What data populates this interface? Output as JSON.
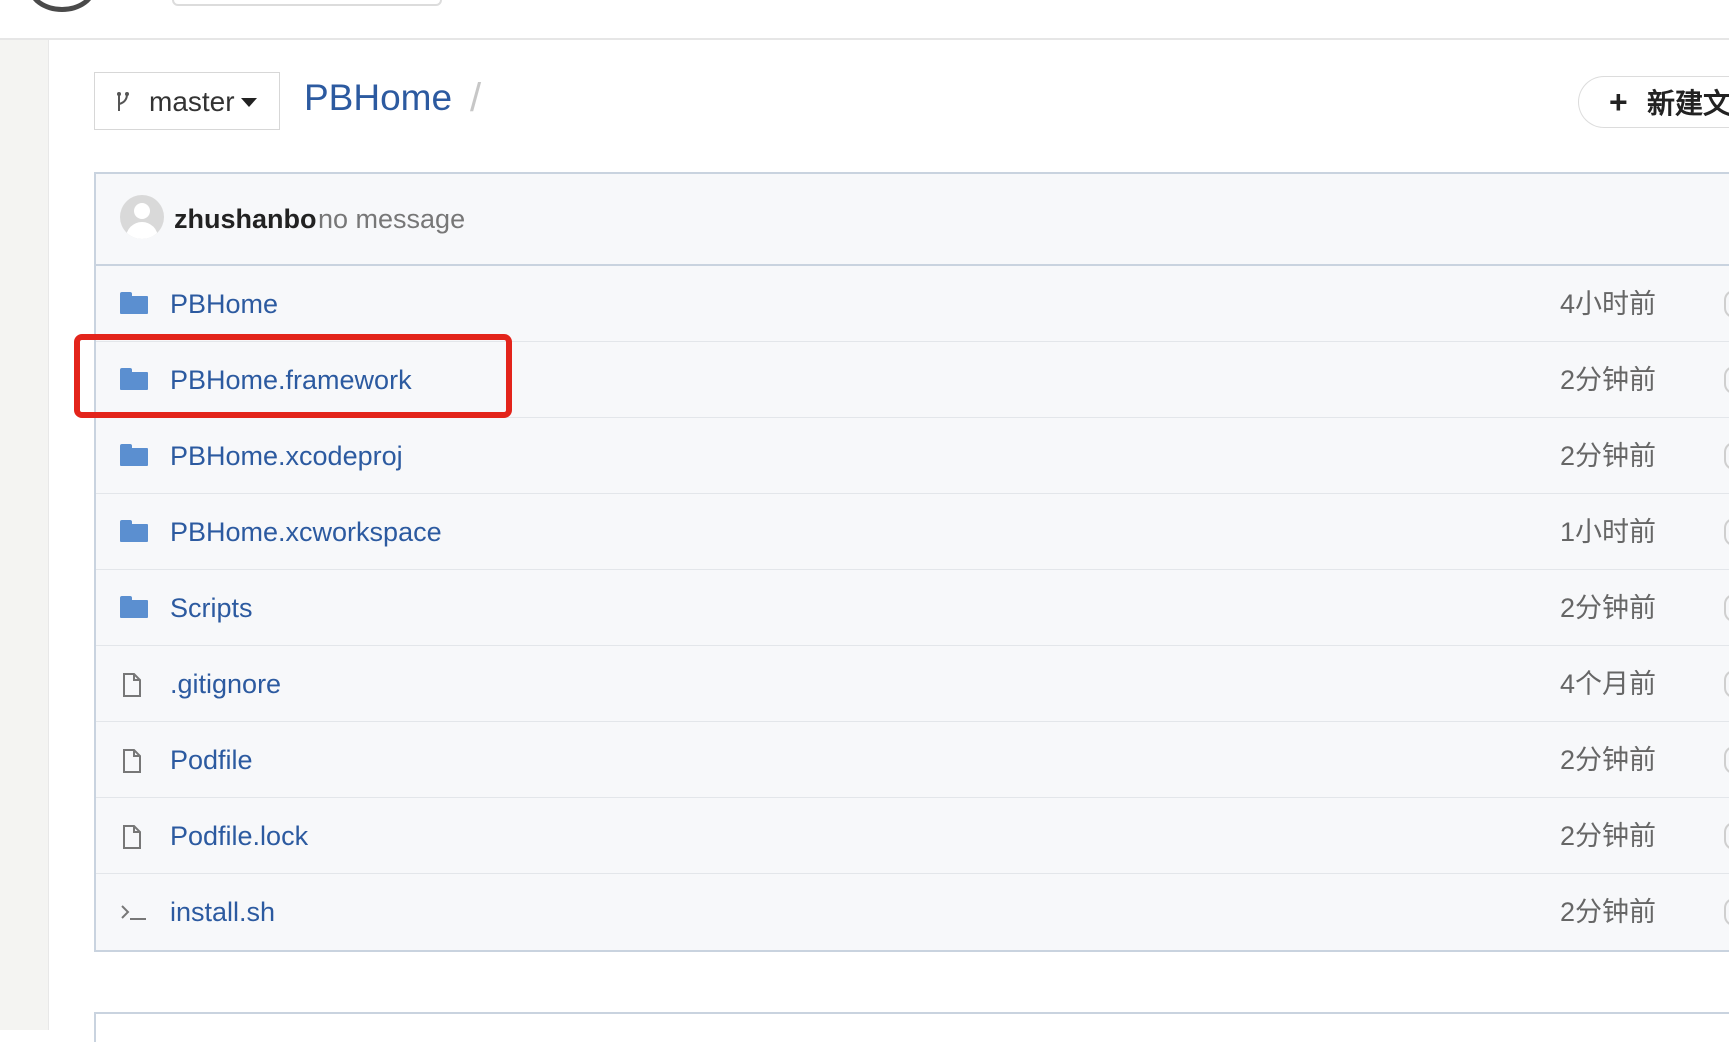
{
  "branch": {
    "label": "master",
    "icon": "git-branch-icon"
  },
  "breadcrumb": {
    "repo": "PBHome",
    "separator": "/"
  },
  "new_file_button": {
    "plus": "+",
    "label": "新建文"
  },
  "commit": {
    "author": "zhushanbo",
    "message": "no message"
  },
  "files": [
    {
      "name": "PBHome",
      "time": "4小时前",
      "icon": "folder-icon"
    },
    {
      "name": "PBHome.framework",
      "time": "2分钟前",
      "icon": "folder-icon"
    },
    {
      "name": "PBHome.xcodeproj",
      "time": "2分钟前",
      "icon": "folder-icon"
    },
    {
      "name": "PBHome.xcworkspace",
      "time": "1小时前",
      "icon": "folder-icon"
    },
    {
      "name": "Scripts",
      "time": "2分钟前",
      "icon": "folder-icon"
    },
    {
      "name": ".gitignore",
      "time": "4个月前",
      "icon": "file-icon"
    },
    {
      "name": "Podfile",
      "time": "2分钟前",
      "icon": "file-icon"
    },
    {
      "name": "Podfile.lock",
      "time": "2分钟前",
      "icon": "file-icon"
    },
    {
      "name": "install.sh",
      "time": "2分钟前",
      "icon": "terminal-icon"
    }
  ],
  "colors": {
    "link": "#2c5aa0",
    "folder": "#5b8fd0",
    "highlight": "#e3241b"
  }
}
